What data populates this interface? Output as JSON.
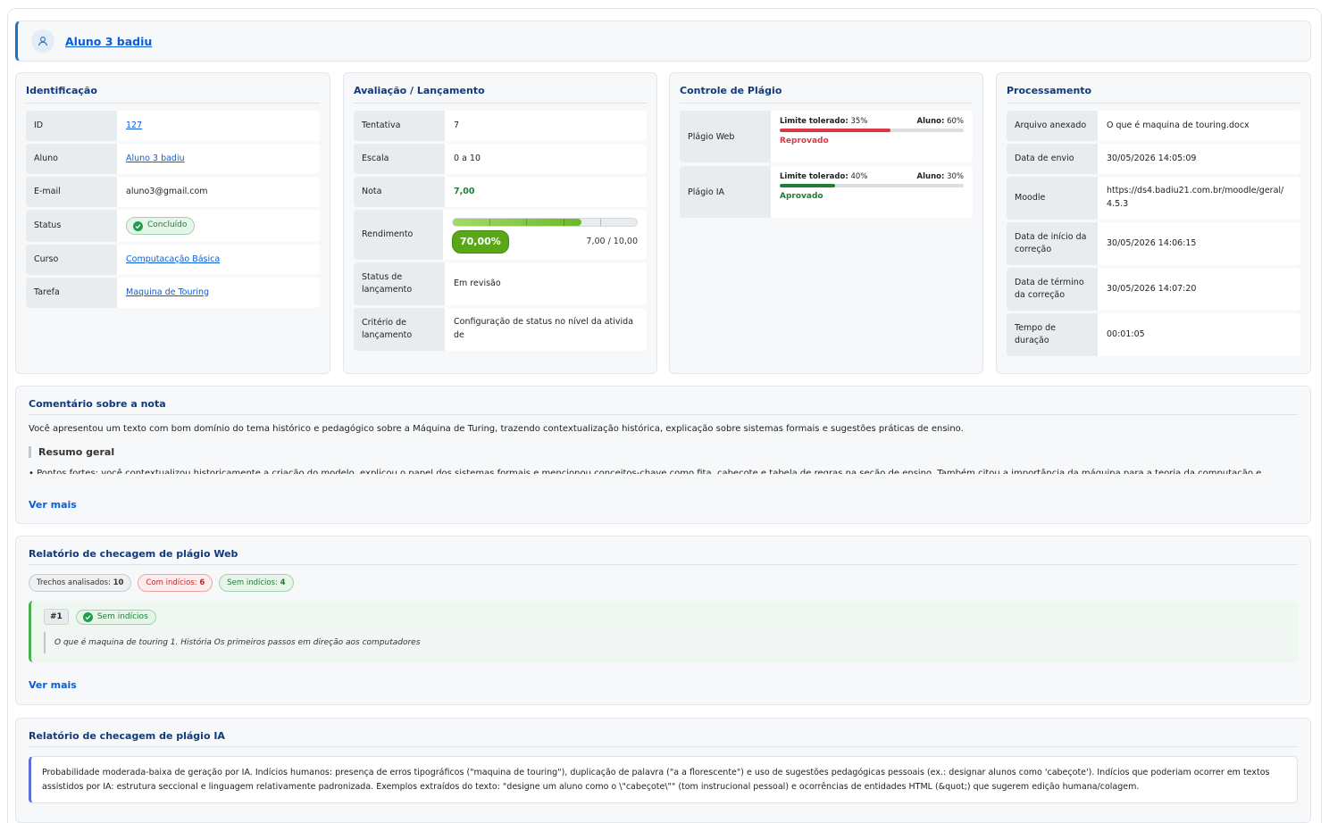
{
  "student": {
    "name": "Aluno 3 badiu"
  },
  "identificacao": {
    "title": "Identificação",
    "rows": [
      {
        "label": "ID",
        "value": "127"
      },
      {
        "label": "Aluno",
        "value": "Aluno 3 badiu"
      },
      {
        "label": "E-mail",
        "value": "aluno3@gmail.com"
      },
      {
        "label": "Status",
        "value": "Concluído"
      },
      {
        "label": "Curso",
        "value": "Computacação Básica"
      },
      {
        "label": "Tarefa",
        "value": "Maquina de Touring"
      }
    ]
  },
  "avaliacao": {
    "title": "Avaliação / Lançamento",
    "rows": [
      {
        "label": "Tentativa",
        "value": "7"
      },
      {
        "label": "Escala",
        "value": "0 a 10"
      },
      {
        "label": "Nota",
        "value": "7,00"
      },
      {
        "label": "Rendimento",
        "value": "70,00%",
        "score": "7,00 / 10,00",
        "fraction": 0.7
      },
      {
        "label": "Status de lançamento",
        "value": "Em revisão"
      },
      {
        "label": "Critério de lançamento",
        "value": "Configuração de status no nível da atividade"
      }
    ]
  },
  "plagio": {
    "title": "Controle de Plágio",
    "rows": [
      {
        "label": "Plágio Web",
        "limit_label": "Limite tolerado:",
        "limit_value": "35%",
        "student_label": "Aluno:",
        "student_value": "60%",
        "fraction": 0.6,
        "status": "Reprovado",
        "color": "#dc3545"
      },
      {
        "label": "Plágio IA",
        "limit_label": "Limite tolerado:",
        "limit_value": "40%",
        "student_label": "Aluno:",
        "student_value": "30%",
        "fraction": 0.3,
        "status": "Aprovado",
        "color": "#1e7e34"
      }
    ]
  },
  "processamento": {
    "title": "Processamento",
    "rows": [
      {
        "label": "Arquivo anexado",
        "value": "O que é maquina de touring.docx"
      },
      {
        "label": "Data de envio",
        "value": "30/05/2026 14:05:09"
      },
      {
        "label": "Moodle",
        "value": "https://ds4.badiu21.com.br/moodle/geral/4.5.3"
      },
      {
        "label": "Data de início da correção",
        "value": "30/05/2026 14:06:15"
      },
      {
        "label": "Data de término da correção",
        "value": "30/05/2026 14:07:20"
      },
      {
        "label": "Tempo de duração",
        "value": "00:01:05"
      }
    ]
  },
  "comentario": {
    "title": "Comentário sobre a nota",
    "text": "Você apresentou um texto com bom domínio do tema histórico e pedagógico sobre a Máquina de Turing, trazendo contextualização histórica, explicação sobre sistemas formais e sugestões práticas de ensino.",
    "resumo_title": "Resumo geral",
    "cut_line": "• Pontos fortes: você contextualizou historicamente a criação do modelo, explicou o papel dos sistemas formais e mencionou conceitos-chave como fita, cabeçote e tabela de regras na seção de ensino. Também citou a importância da máquina para a teoria da computação e",
    "ver_mais": "Ver mais"
  },
  "relatorio_web": {
    "title": "Relatório de checagem de plágio Web",
    "chips": [
      {
        "label": "Trechos analisados:",
        "value": "10"
      },
      {
        "label": "Com indícios:",
        "value": "6"
      },
      {
        "label": "Sem indícios:",
        "value": "4"
      }
    ],
    "snippet": {
      "num": "#1",
      "badge": "Sem indícios",
      "text": "O que é maquina de touring 1. História Os primeiros passos em direção aos computadores"
    },
    "ver_mais": "Ver mais"
  },
  "relatorio_ia": {
    "title": "Relatório de checagem de plágio IA",
    "text": "Probabilidade moderada-baixa de geração por IA. Indícios humanos: presença de erros tipográficos (\"maquina de touring\"), duplicação de palavra (\"a a florescente\") e uso de sugestões pedagógicas pessoais (ex.: designar alunos como 'cabeçote'). Indícios que poderiam ocorrer em textos assistidos por IA: estrutura seccional e linguagem relativamente padronizada. Exemplos extraídos do texto: \"designe um aluno como o \\\"cabeçote\\\"\" (tom instrucional pessoal) e ocorrências de entidades HTML (&quot;) que sugerem edição humana/colagem."
  }
}
